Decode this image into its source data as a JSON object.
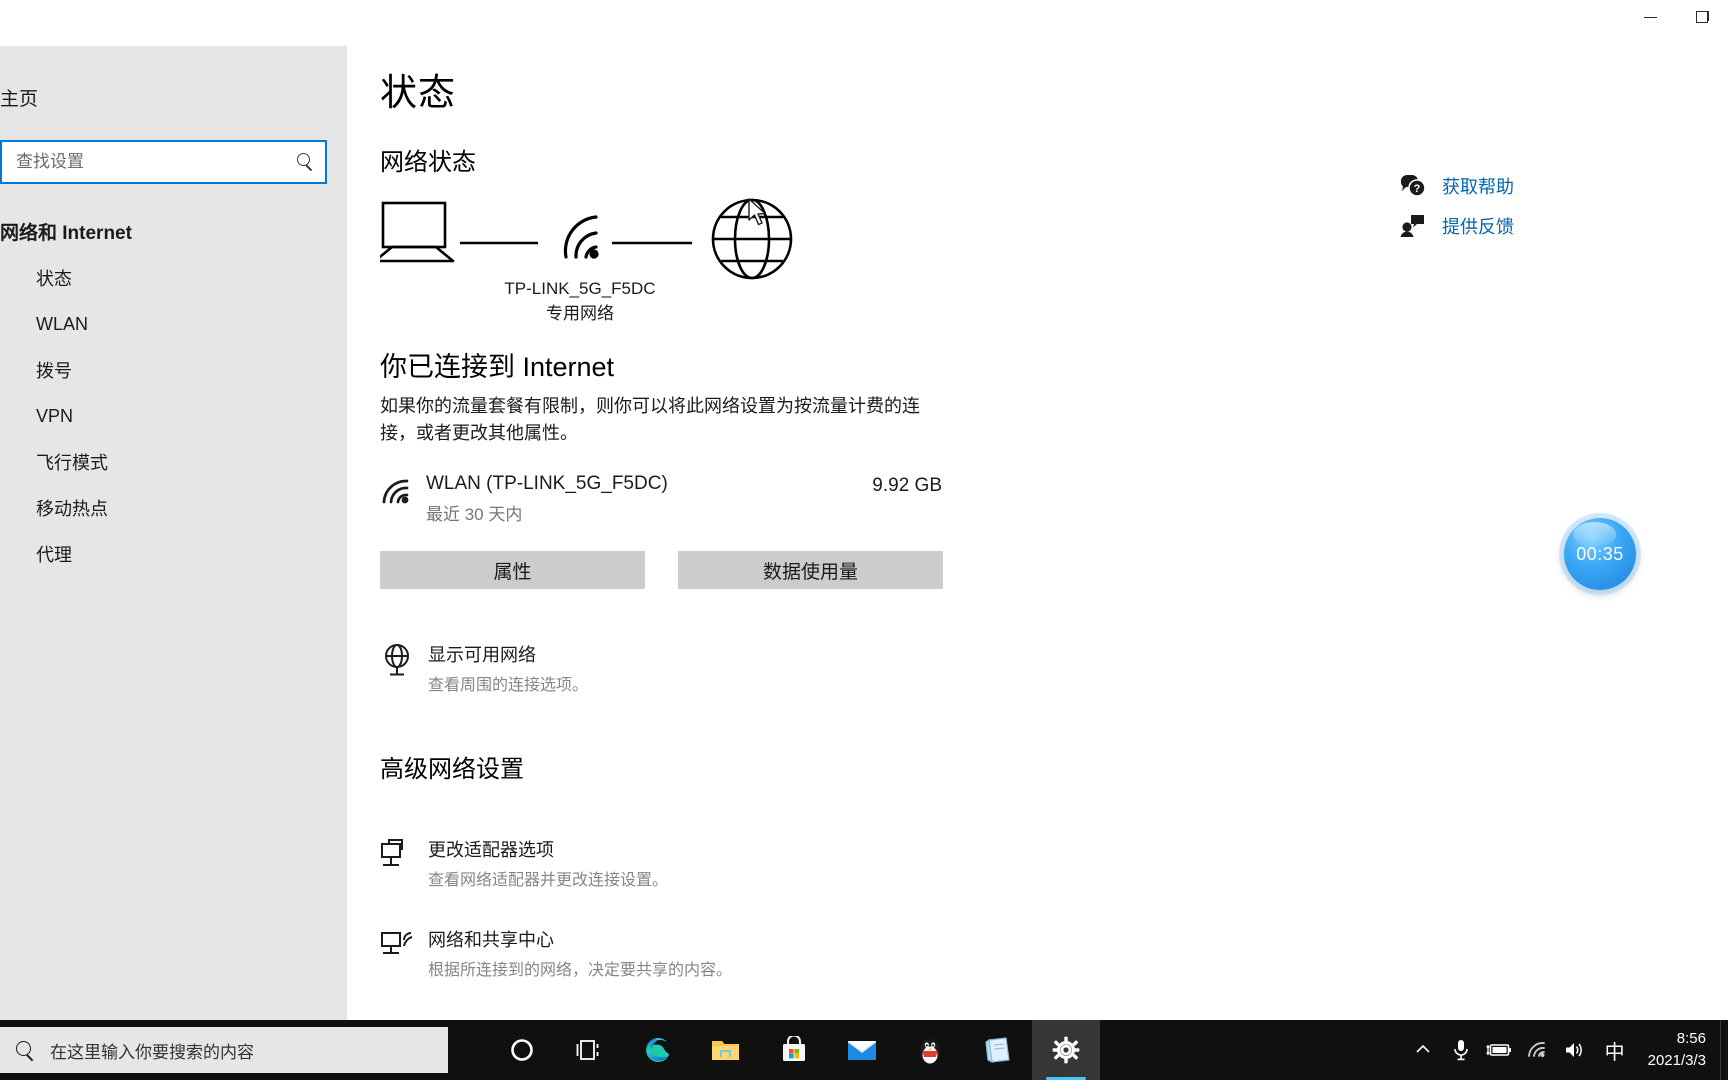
{
  "window": {
    "minimize_label": "最小化",
    "restore_label": "向下还原"
  },
  "nav": {
    "home_label": "主页",
    "search": {
      "placeholder": "查找设置",
      "value": ""
    },
    "category": "网络和 Internet",
    "items": [
      {
        "label": "状态",
        "icon": "status-icon"
      },
      {
        "label": "WLAN",
        "icon": "wifi-icon"
      },
      {
        "label": "拨号",
        "icon": "dialup-icon"
      },
      {
        "label": "VPN",
        "icon": "vpn-icon"
      },
      {
        "label": "飞行模式",
        "icon": "airplane-icon"
      },
      {
        "label": "移动热点",
        "icon": "hotspot-icon"
      },
      {
        "label": "代理",
        "icon": "proxy-icon"
      }
    ]
  },
  "main": {
    "page_title": "状态",
    "network_status_heading": "网络状态",
    "diagram": {
      "device_icon": "laptop-icon",
      "link_icon": "wifi-icon",
      "internet_icon": "globe-icon",
      "ssid": "TP-LINK_5G_F5DC",
      "network_type": "专用网络"
    },
    "connected_title": "你已连接到 Internet",
    "connected_desc": "如果你的流量套餐有限制，则你可以将此网络设置为按流量计费的连接，或者更改其他属性。",
    "adapter": {
      "name": "WLAN (TP-LINK_5G_F5DC)",
      "sub": "最近 30 天内",
      "usage": "9.92 GB"
    },
    "buttons": {
      "properties": "属性",
      "data_usage": "数据使用量"
    },
    "show_networks": {
      "title": "显示可用网络",
      "sub": "查看周围的连接选项。"
    },
    "advanced_heading": "高级网络设置",
    "links": [
      {
        "title": "更改适配器选项",
        "sub": "查看网络适配器并更改连接设置。",
        "icon": "adapter-icon"
      },
      {
        "title": "网络和共享中心",
        "sub": "根据所连接到的网络，决定要共享的内容。",
        "icon": "sharing-icon"
      }
    ]
  },
  "help_panel": {
    "links": [
      {
        "label": "获取帮助",
        "icon": "question-bubble-icon"
      },
      {
        "label": "提供反馈",
        "icon": "feedback-person-icon"
      }
    ],
    "link_color": "#0366b0"
  },
  "float_timer": {
    "value": "00:35",
    "color": "#3aa8f5"
  },
  "taskbar": {
    "search_placeholder": "在这里输入你要搜索的内容",
    "apps": [
      {
        "name": "cortana-icon",
        "label": "Cortana"
      },
      {
        "name": "task-view-icon",
        "label": "任务视图"
      },
      {
        "name": "edge-icon",
        "label": "Microsoft Edge"
      },
      {
        "name": "file-explorer-icon",
        "label": "文件资源管理器"
      },
      {
        "name": "microsoft-store-icon",
        "label": "Microsoft Store"
      },
      {
        "name": "mail-icon",
        "label": "邮件"
      },
      {
        "name": "qq-icon",
        "label": "QQ"
      },
      {
        "name": "notepad-icon",
        "label": "记事本"
      },
      {
        "name": "settings-icon",
        "label": "设置"
      }
    ],
    "tray": {
      "chevron": "显示隐藏的图标",
      "microphone": "麦克风",
      "battery": "电池正在充电",
      "wifi": "网络",
      "volume": "音量",
      "ime": "中"
    },
    "clock": {
      "time": "8:56",
      "date": "2021/3/3"
    }
  }
}
